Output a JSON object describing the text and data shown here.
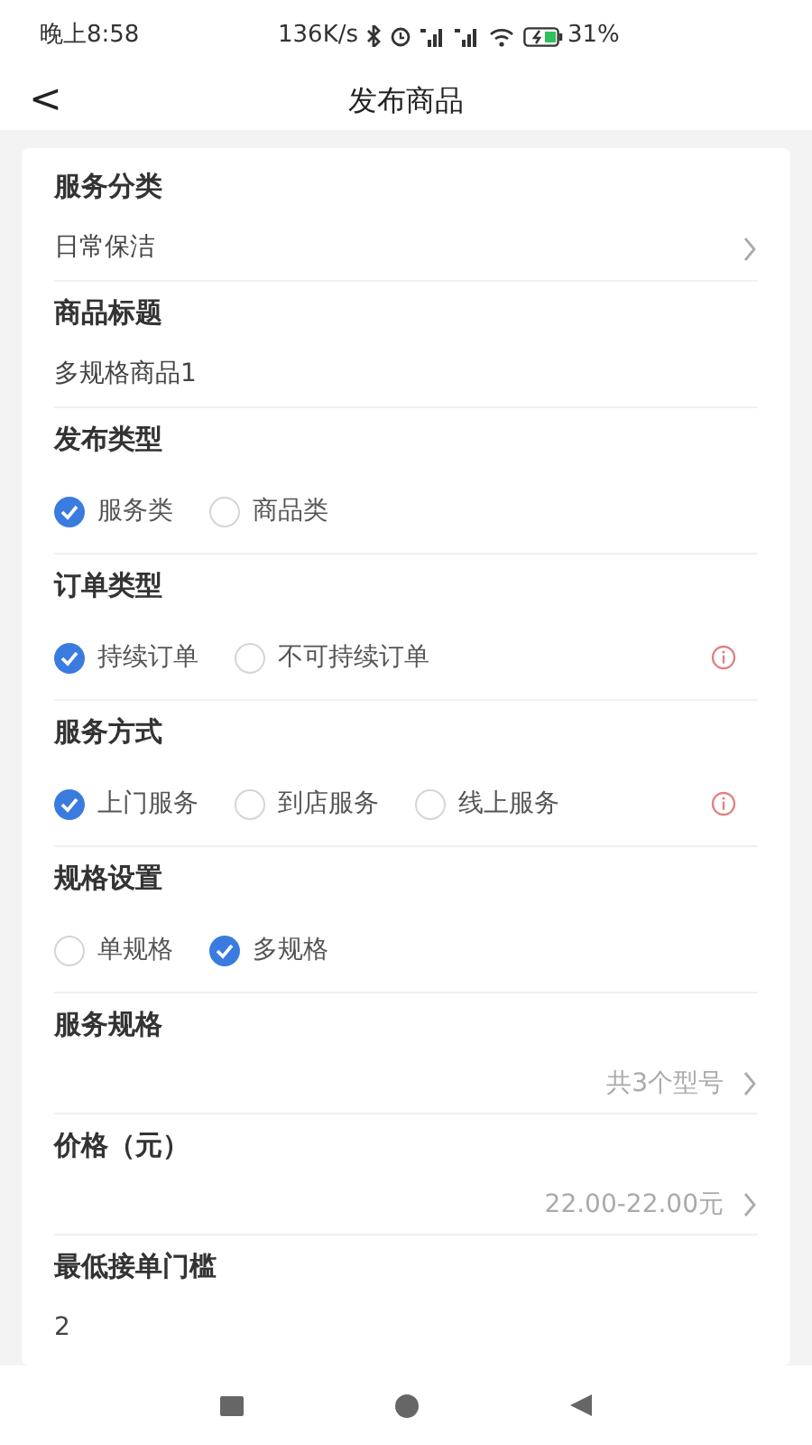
{
  "status_bar": {
    "time": "晚上8:58",
    "speed": "136K/s",
    "battery": "31%"
  },
  "header": {
    "back": "<",
    "title": "发布商品"
  },
  "sections": [
    {
      "kind": "select",
      "label": "服务分类",
      "value": "日常保洁"
    },
    {
      "kind": "text",
      "label": "商品标题",
      "value": "多规格商品1"
    },
    {
      "kind": "radio",
      "label": "发布类型",
      "info": false,
      "options": [
        {
          "label": "服务类",
          "selected": true
        },
        {
          "label": "商品类",
          "selected": false
        }
      ]
    },
    {
      "kind": "radio",
      "label": "订单类型",
      "info": true,
      "options": [
        {
          "label": "持续订单",
          "selected": true
        },
        {
          "label": "不可持续订单",
          "selected": false
        }
      ]
    },
    {
      "kind": "radio",
      "label": "服务方式",
      "info": true,
      "options": [
        {
          "label": "上门服务",
          "selected": true
        },
        {
          "label": "到店服务",
          "selected": false
        },
        {
          "label": "线上服务",
          "selected": false
        }
      ]
    },
    {
      "kind": "radio",
      "label": "规格设置",
      "info": false,
      "options": [
        {
          "label": "单规格",
          "selected": false
        },
        {
          "label": "多规格",
          "selected": true
        }
      ]
    },
    {
      "kind": "link",
      "label": "服务规格",
      "value": "共3个型号"
    },
    {
      "kind": "link",
      "label": "价格（元）",
      "value": "22.00-22.00元"
    },
    {
      "kind": "text",
      "label": "最低接单门槛",
      "value": "2"
    }
  ]
}
